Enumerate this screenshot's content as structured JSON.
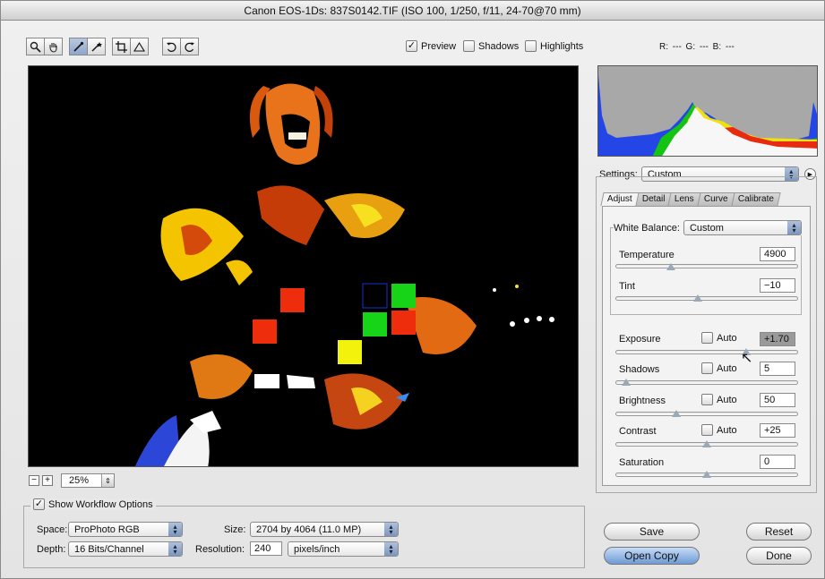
{
  "window": {
    "title": "Canon EOS-1Ds:  837S0142.TIF  (ISO 100, 1/250, f/11, 24-70@70 mm)"
  },
  "toolbar": {
    "tools": [
      {
        "icon": "zoom-icon",
        "glyph": "🔍"
      },
      {
        "icon": "hand-icon",
        "glyph": "✋"
      },
      {
        "icon": "white-balance-eyedropper-icon",
        "glyph": "⁄"
      },
      {
        "icon": "color-sampler-icon",
        "glyph": "✧"
      },
      {
        "icon": "crop-icon",
        "glyph": "⌗"
      },
      {
        "icon": "straighten-icon",
        "glyph": "△"
      },
      {
        "icon": "rotate-left-icon",
        "glyph": "↺"
      },
      {
        "icon": "rotate-right-icon",
        "glyph": "↻"
      }
    ],
    "preview_label": "Preview",
    "shadows_label": "Shadows",
    "highlights_label": "Highlights",
    "rgb_readout": "R: ---  G: ---  B: ---"
  },
  "zoom": {
    "minus": "−",
    "plus": "+",
    "value": "25%"
  },
  "settings": {
    "label": "Settings:",
    "value": "Custom"
  },
  "tabs": [
    "Adjust",
    "Detail",
    "Lens",
    "Curve",
    "Calibrate"
  ],
  "white_balance": {
    "label": "White Balance:",
    "value": "Custom",
    "temperature": {
      "label": "Temperature",
      "value": "4900",
      "level": 0.3
    },
    "tint": {
      "label": "Tint",
      "value": "−10",
      "level": 0.45
    }
  },
  "adjust": {
    "auto_label": "Auto",
    "exposure": {
      "label": "Exposure",
      "value": "+1.70",
      "level": 0.72
    },
    "shadows": {
      "label": "Shadows",
      "value": "5",
      "level": 0.05
    },
    "brightness": {
      "label": "Brightness",
      "value": "50",
      "level": 0.33
    },
    "contrast": {
      "label": "Contrast",
      "value": "+25",
      "level": 0.5
    },
    "saturation": {
      "label": "Saturation",
      "value": "0",
      "level": 0.5
    }
  },
  "workflow": {
    "toggle_label": "Show Workflow Options",
    "space_label": "Space:",
    "space_value": "ProPhoto RGB",
    "depth_label": "Depth:",
    "depth_value": "16 Bits/Channel",
    "size_label": "Size:",
    "size_value": "2704 by 4064 (11.0 MP)",
    "resolution_label": "Resolution:",
    "resolution_value": "240",
    "resolution_unit": "pixels/inch"
  },
  "buttons": {
    "save": "Save",
    "open_copy": "Open Copy",
    "reset": "Reset",
    "done": "Done"
  },
  "colors": {
    "accent": "#7d96bf",
    "histogram_bg": "#a8a8a8"
  }
}
